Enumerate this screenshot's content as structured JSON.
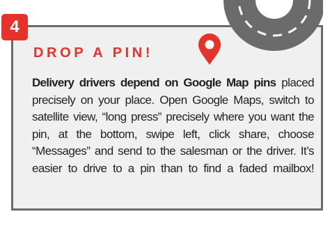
{
  "step": {
    "number": "4"
  },
  "heading": "DROP A PIN!",
  "body": {
    "lead": "Delivery drivers depend on Google Map pins",
    "text": "placed precisely on your place. Open Google Maps, switch to satellite view, “long press” precisely where you want the pin, at the bottom, swipe left, click share, choose “Messages” and send to the salesman or the driver. It’s easier to drive to a pin than to find a faded mailbox!"
  },
  "icons": {
    "pin": "map-pin-icon",
    "road": "road-curve-icon"
  },
  "colors": {
    "accent": "#e6332a",
    "card_background": "#f0f0f0",
    "card_border": "#6a6a6a",
    "road": "#6b6b6b",
    "text": "#231f20"
  }
}
